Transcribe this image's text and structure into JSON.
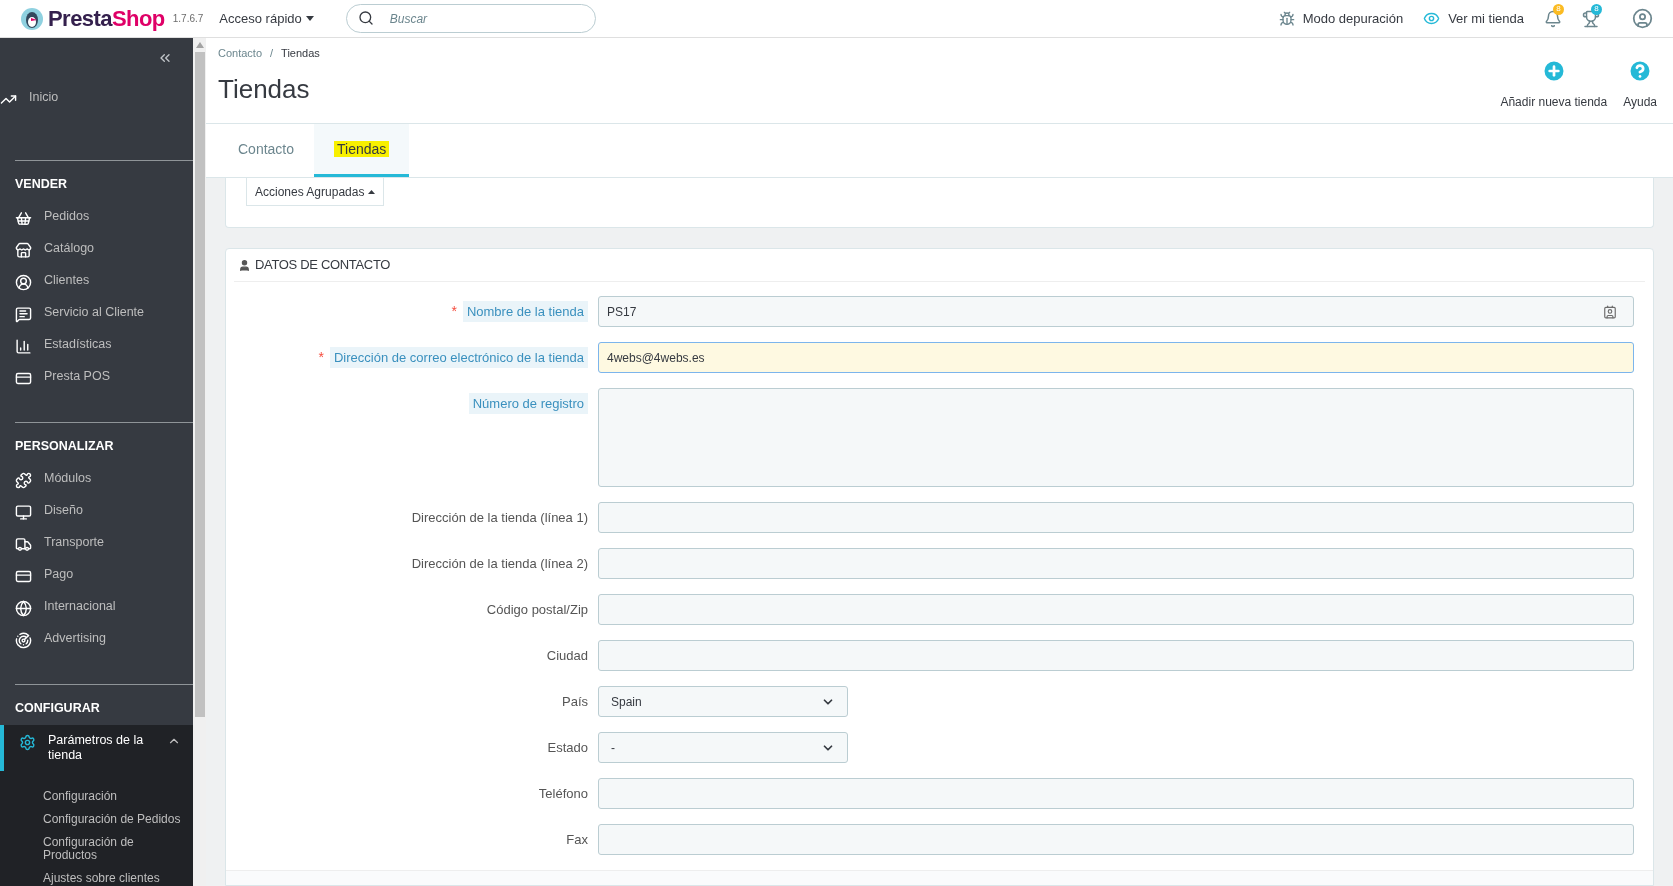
{
  "topbar": {
    "logo_text": [
      "Presta",
      "Shop"
    ],
    "version": "1.7.6.7",
    "quick_access": "Acceso rápido",
    "search": {
      "placeholder": "Buscar"
    },
    "debug_mode": "Modo depuración",
    "view_store": "Ver mi tienda",
    "notifications_badge": "8",
    "trophy_badge": "8"
  },
  "sidebar": {
    "sections": [
      {
        "items": [
          {
            "label": "Inicio",
            "selected": false
          }
        ]
      },
      {
        "title": "VENDER",
        "items": [
          {
            "label": "Pedidos",
            "selected": false
          },
          {
            "label": "Catálogo",
            "selected": false
          },
          {
            "label": "Clientes",
            "selected": false
          },
          {
            "label": "Servicio al Cliente",
            "selected": false
          },
          {
            "label": "Estadísticas",
            "selected": false
          },
          {
            "label": "Presta POS",
            "selected": false
          }
        ]
      },
      {
        "title": "PERSONALIZAR",
        "items": [
          {
            "label": "Módulos",
            "selected": false
          },
          {
            "label": "Diseño",
            "selected": false
          },
          {
            "label": "Transporte",
            "selected": false
          },
          {
            "label": "Pago",
            "selected": false
          },
          {
            "label": "Internacional",
            "selected": false
          },
          {
            "label": "Advertising",
            "selected": false
          }
        ]
      },
      {
        "title": "CONFIGURAR",
        "items": [
          {
            "label": "Parámetros de la tienda",
            "selected": true,
            "expanded": true,
            "children": [
              {
                "label": "Configuración"
              },
              {
                "label": "Configuración de Pedidos"
              },
              {
                "label": "Configuración de Productos"
              },
              {
                "label": "Ajustes sobre clientes"
              }
            ]
          }
        ]
      }
    ]
  },
  "header": {
    "breadcrumb": [
      "Contacto",
      "Tiendas"
    ],
    "breadcrumb_separator": "/",
    "title": "Tiendas",
    "toolbar": [
      {
        "label": "Añadir nueva tienda",
        "kind": "add"
      },
      {
        "label": "Ayuda",
        "kind": "help"
      }
    ]
  },
  "tabs": [
    {
      "label": "Contacto",
      "selected": false,
      "highlighted": false
    },
    {
      "label": "Tiendas",
      "selected": true,
      "highlighted": true
    }
  ],
  "bulk_actions": "Acciones Agrupadas",
  "panel": {
    "title": "DATOS DE CONTACTO",
    "required_mark": "*",
    "fields": [
      {
        "label": "Nombre de la tienda",
        "kind": "text",
        "required": true,
        "hint": true,
        "value": "PS17",
        "focused": false,
        "autofill": true
      },
      {
        "label": "Dirección de correo electrónico de la tienda",
        "kind": "text",
        "required": true,
        "hint": true,
        "value": "4webs@4webs.es",
        "focused": true,
        "autofill": false
      },
      {
        "label": "Número de registro",
        "kind": "textarea",
        "required": false,
        "hint": true,
        "focused": false,
        "autofill": false
      },
      {
        "label": "Dirección de la tienda (línea 1)",
        "kind": "text",
        "required": false,
        "hint": false,
        "focused": false,
        "autofill": false
      },
      {
        "label": "Dirección de la tienda (línea 2)",
        "kind": "text",
        "required": false,
        "hint": false,
        "focused": false,
        "autofill": false
      },
      {
        "label": "Código postal/Zip",
        "kind": "text",
        "required": false,
        "hint": false,
        "focused": false,
        "autofill": false
      },
      {
        "label": "Ciudad",
        "kind": "text",
        "required": false,
        "hint": false,
        "focused": false,
        "autofill": false
      },
      {
        "label": "País",
        "kind": "select",
        "required": false,
        "hint": false,
        "value": "Spain",
        "focused": false,
        "autofill": false
      },
      {
        "label": "Estado",
        "kind": "select",
        "required": false,
        "hint": false,
        "value": "-",
        "focused": false,
        "autofill": false
      },
      {
        "label": "Teléfono",
        "kind": "text",
        "required": false,
        "hint": false,
        "focused": false,
        "autofill": false
      },
      {
        "label": "Fax",
        "kind": "text",
        "required": false,
        "hint": false,
        "focused": false,
        "autofill": false
      }
    ]
  }
}
